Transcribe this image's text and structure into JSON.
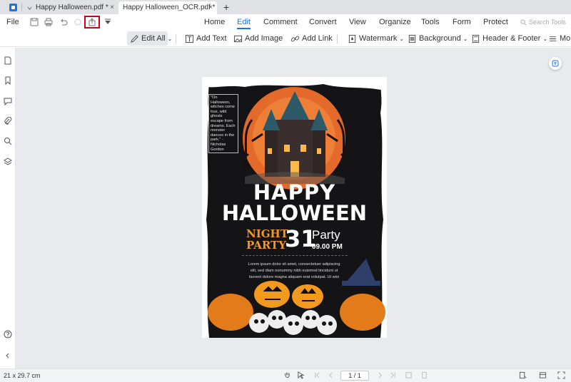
{
  "tabs": [
    {
      "label": "Happy Halloween.pdf *",
      "close": "×"
    },
    {
      "label": "Happy Halloween_OCR.pdf *",
      "close": "×"
    }
  ],
  "new_tab": "+",
  "menu": {
    "file": "File",
    "items": [
      "Home",
      "Edit",
      "Comment",
      "Convert",
      "View",
      "Organize",
      "Tools",
      "Form",
      "Protect"
    ],
    "active": "Edit",
    "search": "Search Tools"
  },
  "toolbar": {
    "edit_all": "Edit All",
    "add_text": "Add Text",
    "add_image": "Add Image",
    "add_link": "Add Link",
    "watermark": "Watermark",
    "background": "Background",
    "header_footer": "Header & Footer",
    "more": "Mo"
  },
  "poster": {
    "quote": "\"On Halloween, witches come true, wild ghosts escape from dreams. Each monster dances in the park.\" - Nicholas Gordon",
    "happy": "HAPPY",
    "halloween": "HALLOWEEN",
    "night": "NIGHT",
    "party_small": "PARTY",
    "day": "31",
    "party": "Party",
    "time": "09.00 PM",
    "body": "Lorem ipsum dolor sit amet, consectetuer adipiscing elit, sed diam nonummy nibh euismod tincidunt ut laoreet dolore magna aliquam erat volutpat. Ut wisi"
  },
  "status": {
    "dimensions": "21 x 29.7 cm",
    "page": "1 / 1"
  },
  "colors": {
    "accent": "#1a73e8",
    "highlight_box": "#d0021b",
    "poster_bg": "#141416",
    "pumpkin": "#f39a1e"
  }
}
